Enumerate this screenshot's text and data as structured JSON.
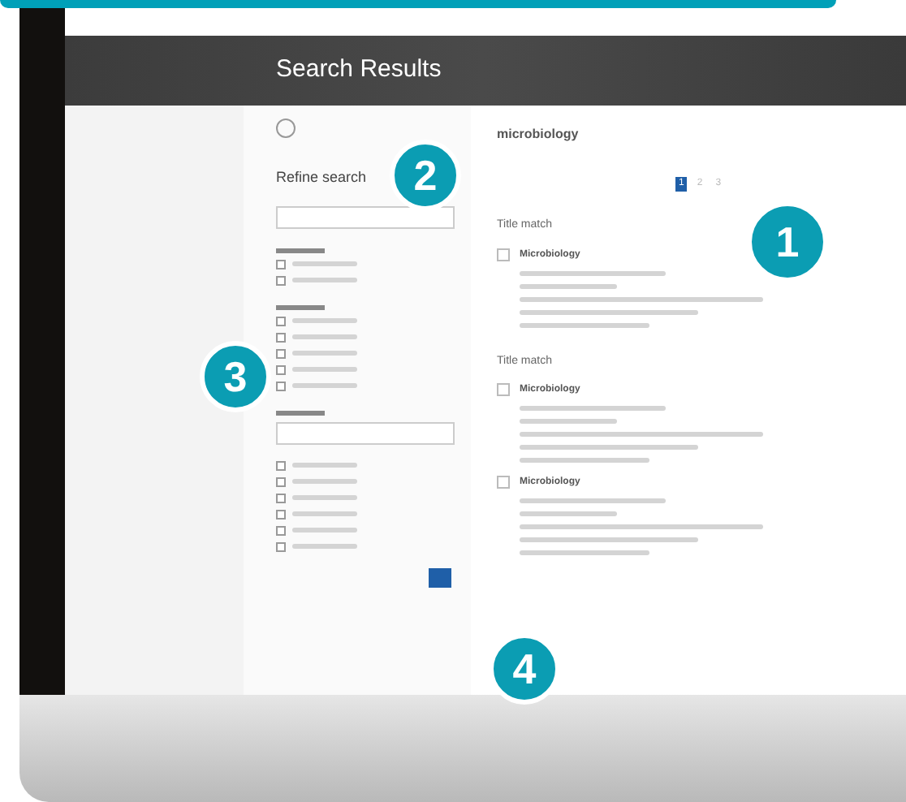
{
  "header": {
    "title": "Search Results"
  },
  "sidebar": {
    "heading": "Refine search",
    "groups": [
      {
        "items": [
          {
            "checked": false
          },
          {
            "checked": false
          }
        ]
      },
      {
        "items": [
          {
            "checked": false
          },
          {
            "checked": false
          },
          {
            "checked": false
          },
          {
            "checked": false
          },
          {
            "checked": false
          }
        ]
      },
      {
        "items": [
          {
            "checked": false
          },
          {
            "checked": false
          },
          {
            "checked": false
          },
          {
            "checked": false
          },
          {
            "checked": false
          },
          {
            "checked": false
          }
        ]
      }
    ]
  },
  "main": {
    "query": "microbiology",
    "pages": [
      {
        "label": "1",
        "selected": true
      },
      {
        "label": "2",
        "selected": false
      },
      {
        "label": "3",
        "selected": false
      }
    ],
    "sections": [
      {
        "heading": "Title match",
        "results": [
          {
            "title": "Microbiology",
            "checked": false
          }
        ]
      },
      {
        "heading": "Title match",
        "results": [
          {
            "title": "Microbiology",
            "checked": false
          },
          {
            "title": "Microbiology",
            "checked": false
          }
        ]
      }
    ]
  },
  "callouts": [
    "1",
    "2",
    "3",
    "4"
  ]
}
